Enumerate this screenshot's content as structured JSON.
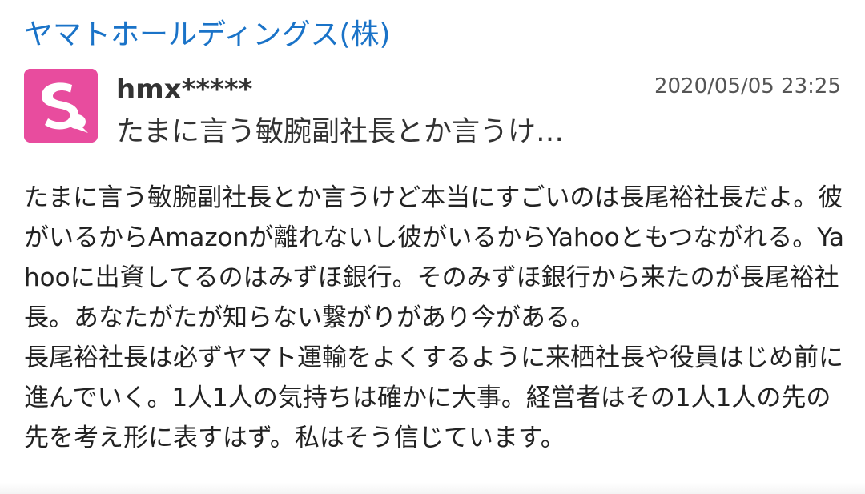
{
  "header": {
    "company_name": "ヤマトホールディングス(株)"
  },
  "post": {
    "avatar_icon": "speech-bubble-icon",
    "avatar_color": "#e84c9e",
    "username": "hmx*****",
    "timestamp": "2020/05/05 23:25",
    "preview": "たまに言う敏腕副社長とか言うけ…",
    "body_paragraphs": [
      "たまに言う敏腕副社長とか言うけど本当にすごいのは長尾裕社長だよ。彼がいるからAmazonが離れないし彼がいるからYahooともつながれる。Yahooに出資してるのはみずほ銀行。そのみずほ銀行から来たのが長尾裕社長。あなたがたが知らない繋がりがあり今がある。",
      "長尾裕社長は必ずヤマト運輸をよくするように来栖社長や役員はじめ前に進んでいく。1人1人の気持ちは確かに大事。経営者はその1人1人の先の先を考え形に表すはず。私はそう信じています。"
    ]
  },
  "colors": {
    "link": "#1a73c8",
    "text": "#222222"
  }
}
